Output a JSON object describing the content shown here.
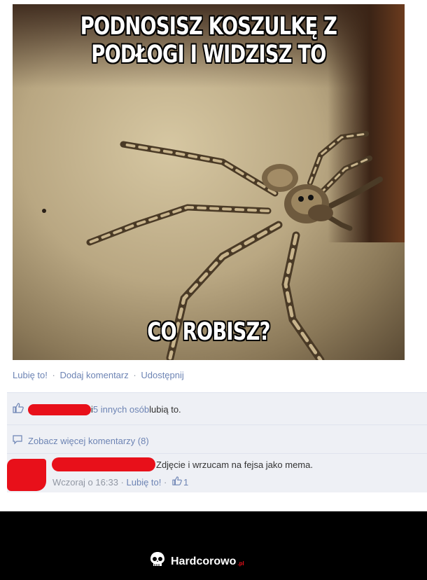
{
  "meme": {
    "top_line_1": "PODNOSISZ KOSZULKĘ Z",
    "top_line_2": "PODŁOGI I WIDZISZ TO",
    "bottom_line": "CO ROBISZ?"
  },
  "actions": {
    "like": "Lubię to!",
    "sep": "·",
    "comment": "Dodaj komentarz",
    "share": "Udostępnij"
  },
  "likes": {
    "prefix": "i ",
    "others": "5 innych osób",
    "suffix": " lubią to."
  },
  "comments": {
    "more": "Zobacz więcej komentarzy (8)",
    "item": {
      "text": "Zdjęcie i wrzucam na fejsa jako mema.",
      "time": "Wczoraj o 16:33",
      "sep": " · ",
      "like": "Lubię to!",
      "sep2": " · ",
      "like_count": "1"
    }
  },
  "footer": {
    "brand": "Hardcorowo",
    "tld": ".pl"
  },
  "icons": {
    "like": "thumbs-up-icon",
    "comment": "speech-bubble-icon",
    "logo": "skull-icon"
  },
  "colors": {
    "link": "#6d84b4",
    "redaction": "#e8101a",
    "panel": "#eef0f5"
  }
}
